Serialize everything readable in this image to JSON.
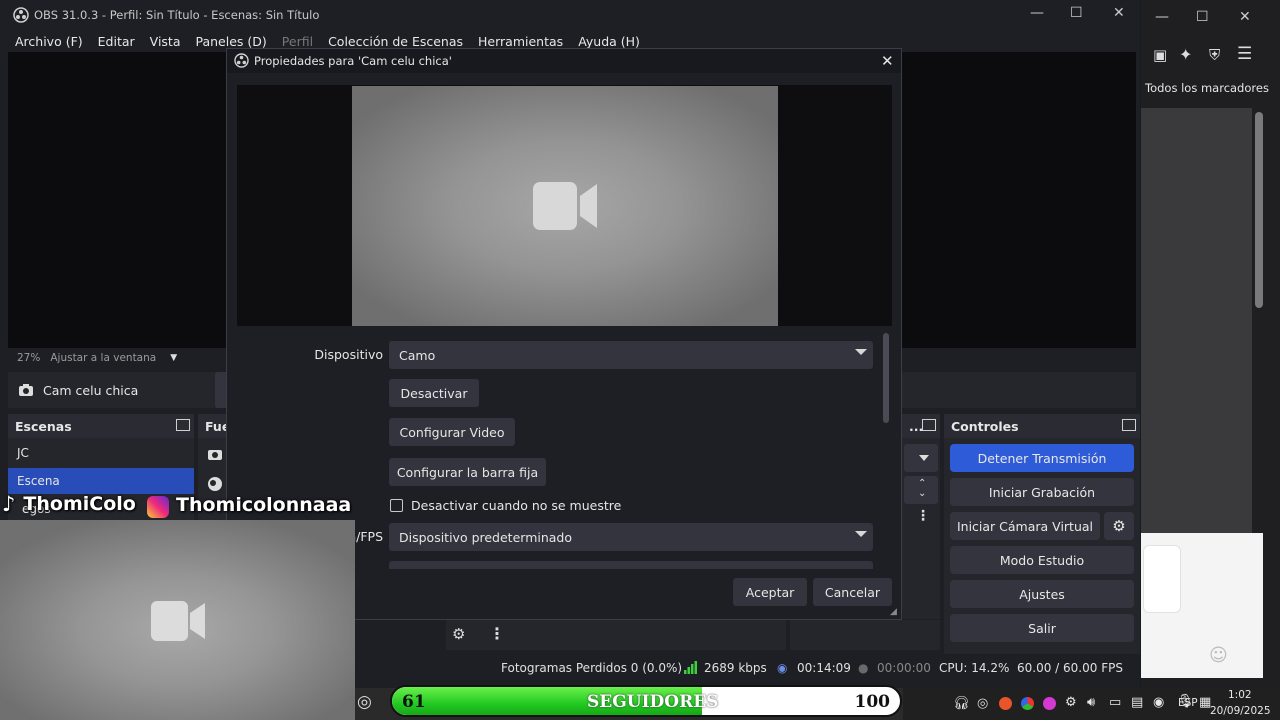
{
  "obs": {
    "title": "OBS 31.0.3 - Perfil: Sin Título - Escenas: Sin Título",
    "menu": [
      "Archivo (F)",
      "Editar",
      "Vista",
      "Paneles (D)",
      "Perfil",
      "Colección de Escenas",
      "Herramientas",
      "Ayuda (H)"
    ],
    "zoom": "27%",
    "zoom_mode": "Ajustar a la ventana",
    "source_name": "Cam celu chica",
    "scenes_header": "Escenas",
    "scenes": [
      "JC",
      "Escena"
    ],
    "sources_header": "Fue",
    "controls_header": "Controles",
    "controls": {
      "stop_stream": "Detener Transmisión",
      "start_record": "Iniciar Grabación",
      "virtual_cam": "Iniciar Cámara Virtual",
      "studio_mode": "Modo Estudio",
      "settings": "Ajustes",
      "exit": "Salir"
    },
    "status": {
      "dropped_frames": "Fotogramas Perdidos 0 (0.0%)",
      "bitrate": "2689 kbps",
      "stream_time": "00:14:09",
      "record_time": "00:00:00",
      "cpu": "CPU: 14.2%",
      "fps": "60.00 / 60.00 FPS"
    }
  },
  "dialog": {
    "title": "Propiedades para 'Cam celu chica'",
    "device_label": "Dispositivo",
    "device_value": "Camo",
    "btn_deactivate": "Desactivar",
    "btn_config_video": "Configurar Video",
    "btn_config_crossbar": "Configurar la barra fija",
    "checkbox_label": "Desactivar cuando no se muestre",
    "resfps_label_partial": "n/FPS",
    "resfps_value": "Dispositivo predeterminado",
    "ok": "Aceptar",
    "cancel": "Cancelar"
  },
  "browser": {
    "bookmarks": "Todos los marcadores"
  },
  "overlay": {
    "tiktok": "ThomiColo",
    "instagram": "Thomicolonnaaa",
    "followers_current": "61",
    "followers_label": "SEGUIDORES",
    "followers_goal": "100",
    "followers_fraction": 0.61,
    "partial_text": "egos"
  },
  "taskbar": {
    "lang": "ESP",
    "time": "1:02",
    "date": "20/09/2025"
  },
  "colors": {
    "accent_blue": "#2e5bd8",
    "selected_scene": "#284cb8",
    "follower_green": "#22c922"
  }
}
